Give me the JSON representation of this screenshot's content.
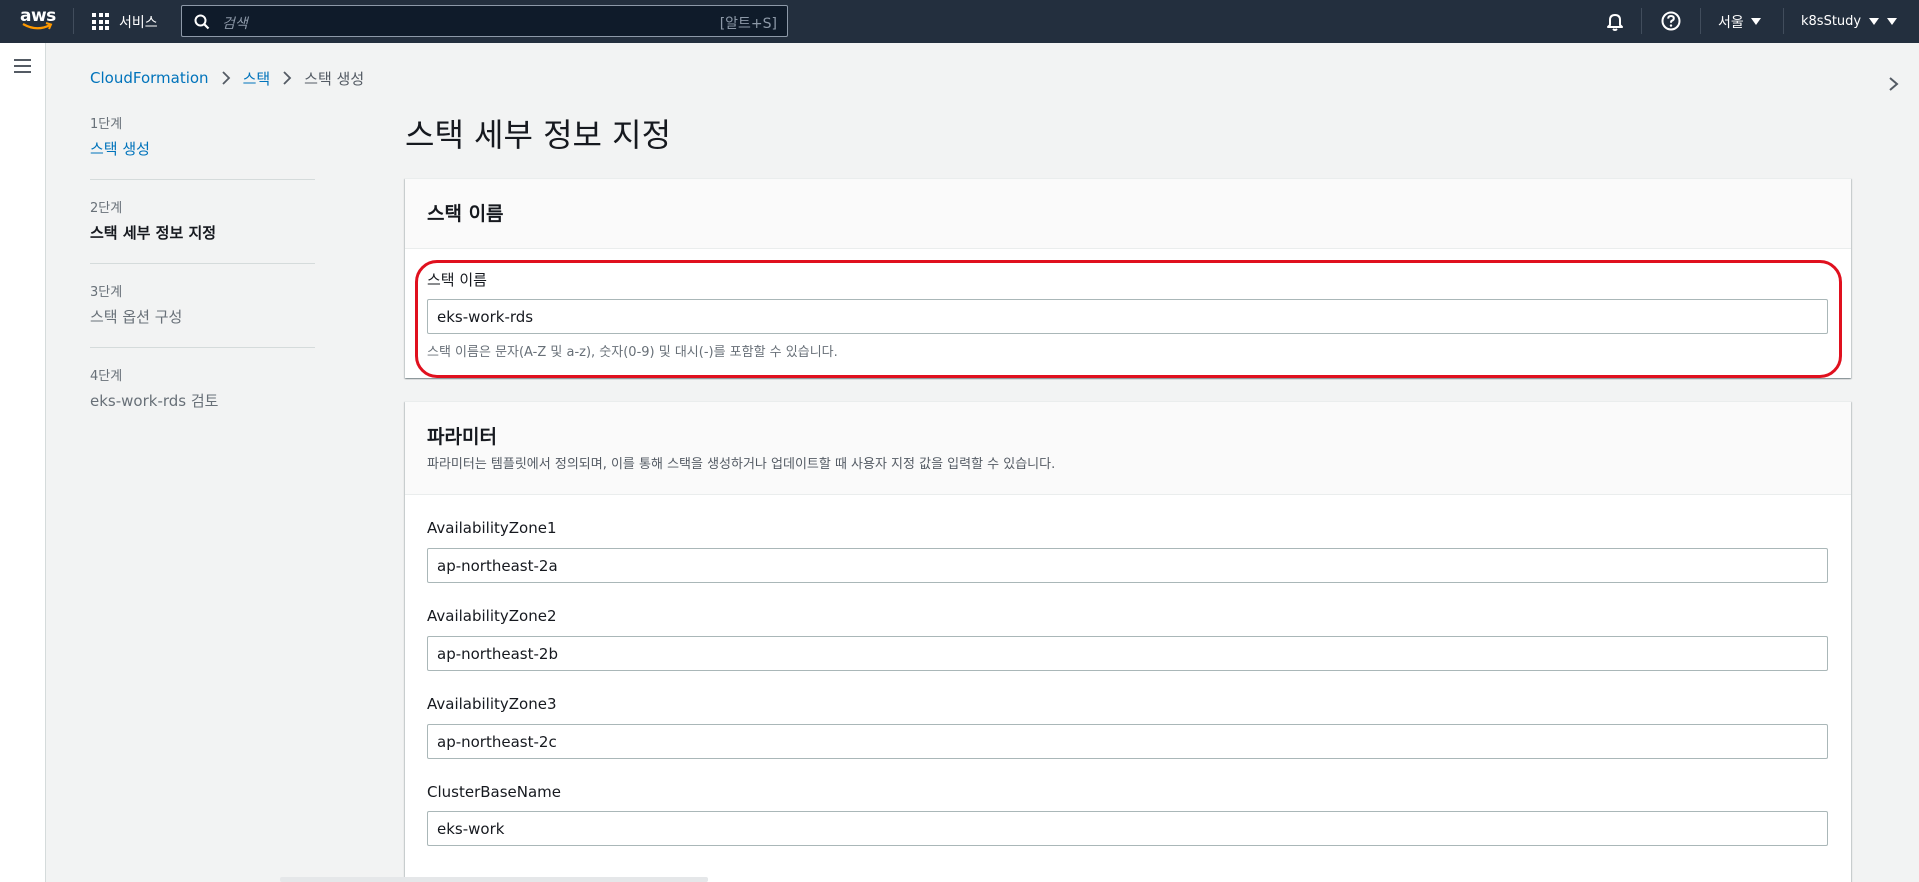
{
  "topnav": {
    "logo_text": "aws",
    "services_label": "서비스",
    "search_placeholder": "검색",
    "search_shortcut": "[알트+S]",
    "region_label": "서울",
    "account_label": "k8sStudy",
    "icons": [
      "grid-icon",
      "search-icon",
      "bell-icon",
      "help-icon"
    ]
  },
  "breadcrumb": {
    "items": [
      "CloudFormation",
      "스택",
      "스택 생성"
    ]
  },
  "steps": [
    {
      "num": "1단계",
      "title": "스택 생성",
      "state": "link"
    },
    {
      "num": "2단계",
      "title": "스택 세부 정보 지정",
      "state": "active"
    },
    {
      "num": "3단계",
      "title": "스택 옵션 구성",
      "state": "muted"
    },
    {
      "num": "4단계",
      "title": "eks-work-rds 검토",
      "state": "muted"
    }
  ],
  "page_title": "스택 세부 정보 지정",
  "stack_name_card": {
    "title": "스택 이름",
    "field_label": "스택 이름",
    "field_value": "eks-work-rds",
    "hint": "스택 이름은 문자(A-Z 및 a-z), 숫자(0-9) 및 대시(-)를 포함할 수 있습니다."
  },
  "params_card": {
    "title": "파라미터",
    "description": "파라미터는 템플릿에서 정의되며, 이를 통해 스택을 생성하거나 업데이트할 때 사용자 지정 값을 입력할 수 있습니다.",
    "fields": [
      {
        "label": "AvailabilityZone1",
        "value": "ap-northeast-2a"
      },
      {
        "label": "AvailabilityZone2",
        "value": "ap-northeast-2b"
      },
      {
        "label": "AvailabilityZone3",
        "value": "ap-northeast-2c"
      },
      {
        "label": "ClusterBaseName",
        "value": "eks-work"
      }
    ]
  },
  "colors": {
    "nav_bg": "#232f3e",
    "link": "#0073bb",
    "highlight": "#e0101e",
    "page_bg": "#f2f3f3"
  }
}
